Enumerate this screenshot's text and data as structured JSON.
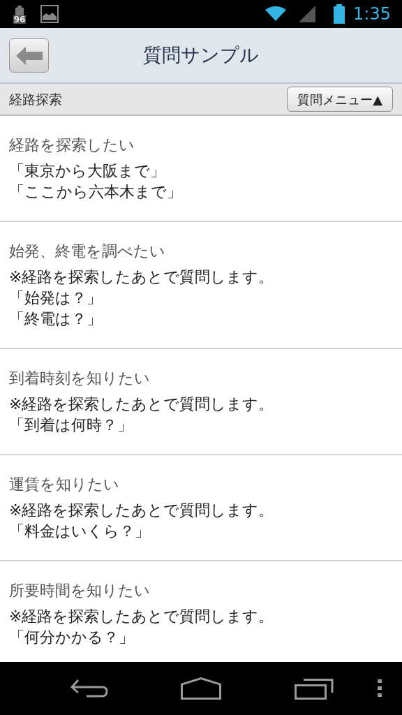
{
  "status_bar": {
    "battery_badge": "96",
    "time": "1:35"
  },
  "header": {
    "title": "質問サンプル"
  },
  "subheader": {
    "label": "経路探索",
    "menu_button": "質問メニュー▲"
  },
  "items": [
    {
      "title": "経路を探索したい",
      "lines": [
        "「東京から大阪まで」",
        "「ここから六本木まで」"
      ]
    },
    {
      "title": "始発、終電を調べたい",
      "lines": [
        "※経路を探索したあとで質問します。",
        "「始発は？」",
        "「終電は？」"
      ]
    },
    {
      "title": "到着時刻を知りたい",
      "lines": [
        "※経路を探索したあとで質問します。",
        "「到着は何時？」"
      ]
    },
    {
      "title": "運賃を知りたい",
      "lines": [
        "※経路を探索したあとで質問します。",
        "「料金はいくら？」"
      ]
    },
    {
      "title": "所要時間を知りたい",
      "lines": [
        "※経路を探索したあとで質問します。",
        "「何分かかる？」"
      ]
    }
  ]
}
